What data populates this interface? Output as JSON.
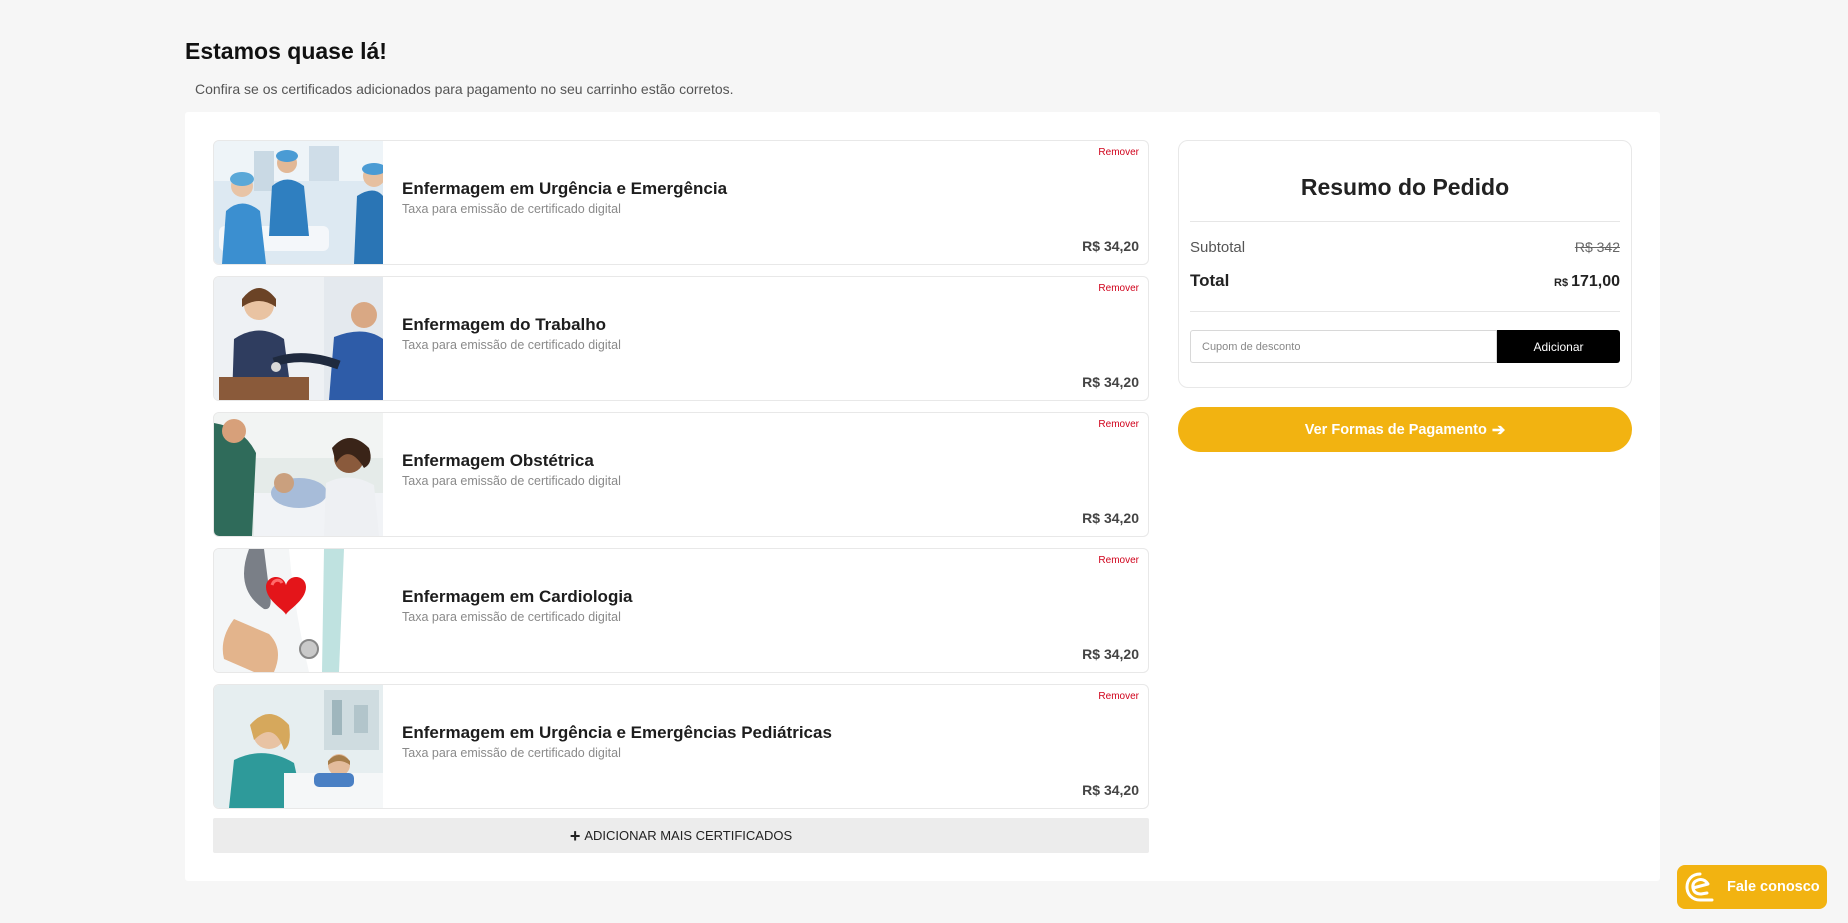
{
  "page": {
    "title": "Estamos quase lá!",
    "subtitle": "Confira se os certificados adicionados para pagamento no seu carrinho estão corretos."
  },
  "cart": {
    "remove_label": "Remover",
    "items": [
      {
        "title": "Enfermagem em Urgência e Emergência",
        "description": "Taxa para emissão de certificado digital",
        "price": "R$ 34,20",
        "image": "nurses-running-gurney"
      },
      {
        "title": "Enfermagem do Trabalho",
        "description": "Taxa para emissão de certificado digital",
        "price": "R$ 34,20",
        "image": "nurse-measuring-blood-pressure"
      },
      {
        "title": "Enfermagem Obstétrica",
        "description": "Taxa para emissão de certificado digital",
        "price": "R$ 34,20",
        "image": "mother-with-newborn"
      },
      {
        "title": "Enfermagem em Cardiologia",
        "description": "Taxa para emissão de certificado digital",
        "price": "R$ 34,20",
        "image": "hand-holding-red-heart"
      },
      {
        "title": "Enfermagem em Urgência e Emergências Pediátricas",
        "description": "Taxa para emissão de certificado digital",
        "price": "R$ 34,20",
        "image": "nurse-with-child-patient"
      }
    ],
    "add_more_label": "ADICIONAR MAIS CERTIFICADOS"
  },
  "summary": {
    "title": "Resumo do Pedido",
    "subtotal_label": "Subtotal",
    "subtotal_value": "R$ 342",
    "total_label": "Total",
    "total_currency": "R$",
    "total_value": "171,00",
    "coupon_placeholder": "Cupom de desconto",
    "coupon_button": "Adicionar"
  },
  "payment_button": "Ver Formas de Pagamento",
  "chat": {
    "label": "Fale conosco"
  },
  "colors": {
    "accent": "#f2b311",
    "remove": "#d0021b",
    "button_dark": "#000000"
  }
}
